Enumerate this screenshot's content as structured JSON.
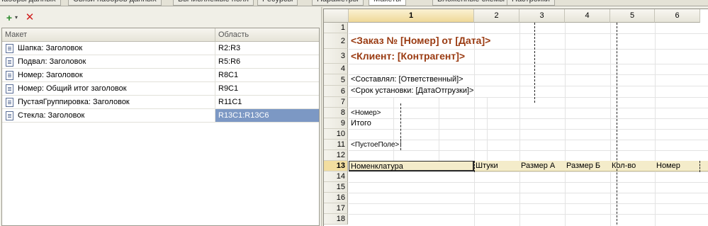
{
  "tabs": [
    {
      "label": "Наборы данных",
      "active": false
    },
    {
      "label": "Связи наборов данных",
      "active": false
    },
    {
      "label": "Вычисляемые поля",
      "active": false
    },
    {
      "label": "Ресурсы",
      "active": false
    },
    {
      "label": "Параметры",
      "active": false
    },
    {
      "label": "Макеты",
      "active": true
    },
    {
      "label": "Вложенные схемы",
      "active": false
    },
    {
      "label": "Настройки",
      "active": false
    }
  ],
  "toolbar": {
    "add_icon": "add-icon",
    "add_arrow_icon": "dropdown-arrow-icon",
    "delete_icon": "delete-icon"
  },
  "layouts_table": {
    "headers": [
      "Макет",
      "Область"
    ],
    "rows": [
      {
        "name": "Шапка: Заголовок",
        "area": "R2:R3",
        "selected": false
      },
      {
        "name": "Подвал: Заголовок",
        "area": "R5:R6",
        "selected": false
      },
      {
        "name": "Номер: Заголовок",
        "area": "R8C1",
        "selected": false
      },
      {
        "name": "Номер: Общий итог заголовок",
        "area": "R9C1",
        "selected": false
      },
      {
        "name": "ПустаяГруппировка: Заголовок",
        "area": "R11C1",
        "selected": false
      },
      {
        "name": "Стекла: Заголовок",
        "area": "R13C1:R13C6",
        "selected": true
      }
    ]
  },
  "sheet": {
    "columns": [
      "1",
      "2",
      "3",
      "4",
      "5",
      "6"
    ],
    "active_column": "1",
    "rows": [
      "1",
      "2",
      "3",
      "4",
      "5",
      "6",
      "7",
      "8",
      "9",
      "10",
      "11",
      "12",
      "13",
      "14",
      "15",
      "16",
      "17",
      "18"
    ],
    "active_row": "13",
    "cells": {
      "r2": "<Заказ №  [Номер]  от [Дата]>",
      "r3": "<Клиент: [Контрагент]>",
      "r5": "<Составлял: [Ответственный]>",
      "r6": "<Срок установки: [ДатаОтгрузки]>",
      "r8": "<Номер>",
      "r9": "Итого",
      "r11": "<ПустоеПоле>",
      "r13": [
        "Номенклатура",
        "Штуки",
        "Размер А",
        "Размер Б",
        "Кол-во",
        "Номер"
      ]
    }
  }
}
